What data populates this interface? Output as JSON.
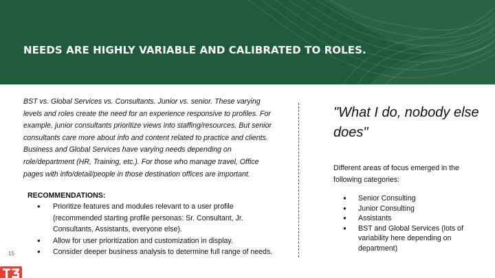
{
  "header": {
    "title": "NEEDS ARE HIGHLY VARIABLE AND CALIBRATED TO ROLES."
  },
  "left": {
    "intro": "BST vs. Global Services vs. Consultants. Junior vs. senior. These varying levels and roles create the need for an experience responsive to profiles. For example, junior consultants prioritize views into staffing/resources. But senior consultants care more about info and content related to practice and clients. Business and Global Services have varying needs depending on role/department (HR, Training, etc.). For those who manage travel, Office pages with info/detail/people in those destination offices are important.",
    "recommendations_heading": "RECOMMENDATIONS:",
    "recommendations": [
      "Prioritize features and modules relevant to a user profile (recommended starting profile personas: Sr. Consultant, Jr. Consultants, Assistants, everyone else).",
      "Allow for user prioritization and customization in display.",
      "Consider deeper business analysis to determine full range of needs."
    ]
  },
  "right": {
    "quote": "\"What I do, nobody else does\"",
    "areas_text": "Different areas of focus emerged in the following categories:",
    "areas": [
      "Senior Consulting",
      "Junior Consulting",
      "Assistants",
      "BST and Global Services (lots of variability here depending on department)"
    ]
  },
  "footer": {
    "page_number": "15",
    "logo_text": "T3"
  },
  "colors": {
    "header_bg": "#1f5a3a",
    "logo_red": "#e8402d",
    "page_number": "#2f7a4f"
  }
}
